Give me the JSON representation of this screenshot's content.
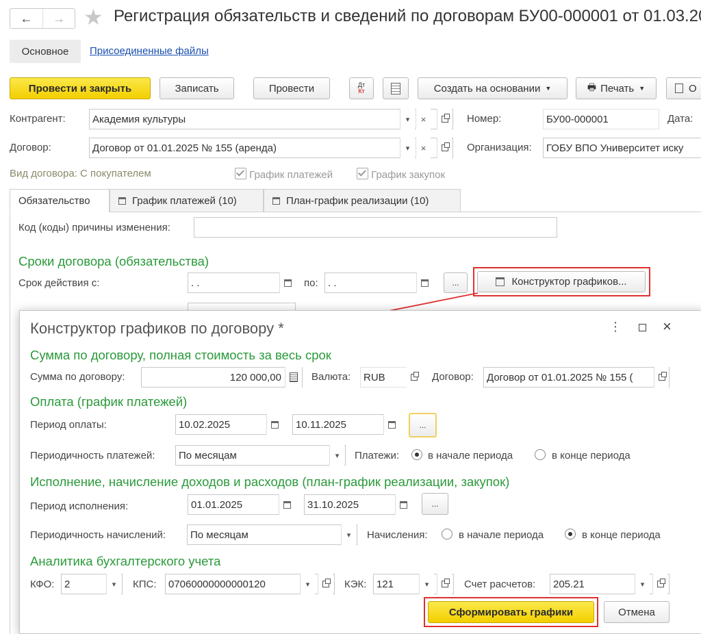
{
  "header": {
    "title": "Регистрация обязательств и сведений по договорам БУ00-000001 от 01.03.20",
    "back": "←",
    "forward": "→",
    "star": "★"
  },
  "nav": {
    "main": "Основное",
    "attached": "Присоединенные файлы"
  },
  "toolbar": {
    "post_close": "Провести и закрыть",
    "save": "Записать",
    "post": "Провести",
    "dt_kt_top": "Дт",
    "dt_kt_bottom": "Кт",
    "create_based": "Создать на основании",
    "print": "Печать",
    "more": "О"
  },
  "form": {
    "counterparty_label": "Контрагент:",
    "counterparty": "Академия культуры",
    "contract_label": "Договор:",
    "contract": "Договор от 01.01.2025 № 155 (аренда)",
    "number_label": "Номер:",
    "number": "БУ00-000001",
    "date_label": "Дата:",
    "org_label": "Организация:",
    "org": "ГОБУ ВПО Университет иску",
    "contract_type": "Вид договора: С покупателем",
    "payment_schedule_cb": "График платежей",
    "purchase_schedule_cb": "График закупок"
  },
  "tabs": [
    {
      "label": "Обязательство"
    },
    {
      "label": "График платежей (10)"
    },
    {
      "label": "План-график реализации (10)"
    }
  ],
  "obligation": {
    "reason_label": "Код (коды) причины изменения:",
    "terms_title": "Сроки договора (обязательства)",
    "term_label": "Срок действия с:",
    "date_from": " .  .",
    "to_label": "по:",
    "date_to": " .  .",
    "dots": "...",
    "constructor_btn": "Конструктор графиков..."
  },
  "dialog": {
    "title": "Конструктор графиков по договору *",
    "sum_section": "Сумма по договору, полная стоимость за весь срок",
    "sum_label": "Сумма по договору:",
    "sum": "120 000,00",
    "currency_label": "Валюта:",
    "currency": "RUB",
    "contract_label": "Договор:",
    "contract": "Договор от 01.01.2025 № 155 (",
    "payment_section": "Оплата (график платежей)",
    "pay_period_label": "Период оплаты:",
    "pay_from": "10.02.2025",
    "pay_to": "10.11.2025",
    "dots": "...",
    "pay_freq_label": "Периодичность платежей:",
    "pay_freq": "По месяцам",
    "payments_label": "Платежи:",
    "start_of_period": "в начале периода",
    "end_of_period": "в конце периода",
    "exec_section": "Исполнение, начисление доходов и расходов (план-график реализации, закупок)",
    "exec_period_label": "Период исполнения:",
    "exec_from": "01.01.2025",
    "exec_to": "31.10.2025",
    "accr_freq_label": "Периодичность начислений:",
    "accr_freq": "По месяцам",
    "accruals_label": "Начисления:",
    "analytics_section": "Аналитика бухгалтерского учета",
    "kfo_label": "КФО:",
    "kfo": "2",
    "kps_label": "КПС:",
    "kps": "07060000000000120",
    "kek_label": "КЭК:",
    "kek": "121",
    "account_label": "Счет расчетов:",
    "account": "205.21",
    "generate_btn": "Сформировать графики",
    "cancel_btn": "Отмена"
  },
  "colors": {
    "accent_yellow": "#f5d300",
    "highlight_red": "#e03030",
    "section_green": "#2a9a3a",
    "link_blue": "#1a4fb0"
  }
}
